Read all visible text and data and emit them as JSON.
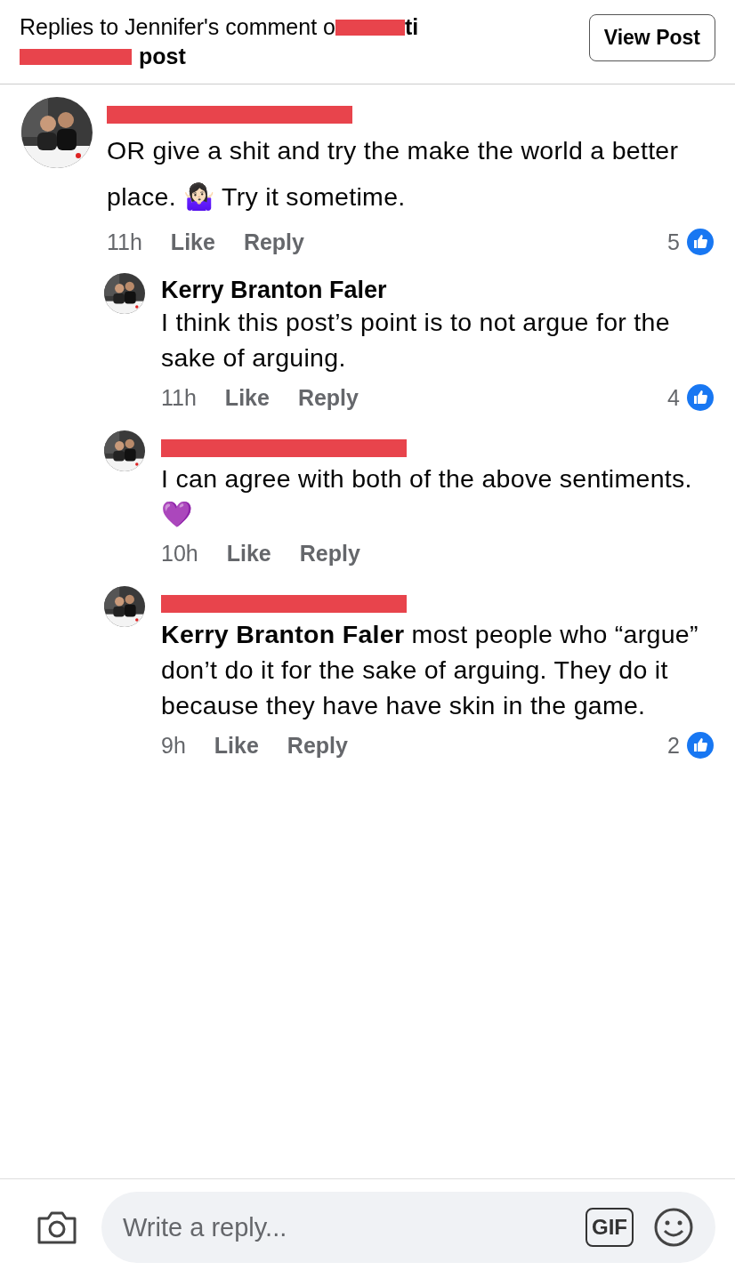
{
  "header": {
    "title_line1": "Replies to Jennifer's comment o",
    "title_line1_tail": "ti",
    "title_line2": "post",
    "button": "View Post"
  },
  "comments": [
    {
      "redacted": true,
      "text": "OR give a shit and try the make the world a better place. 🤷🏻‍♀️ Try it sometime.",
      "time": "11h",
      "like": "Like",
      "reply": "Reply",
      "reactions": "5",
      "replies": [
        {
          "name": "Kerry Branton Faler",
          "redacted": false,
          "text": "I think this post’s point is to not argue for the sake of arguing.",
          "time": "11h",
          "like": "Like",
          "reply": "Reply",
          "reactions": "4"
        },
        {
          "redacted": true,
          "text": "I can agree with both of the above sentiments. 💜",
          "time": "10h",
          "like": "Like",
          "reply": "Reply"
        },
        {
          "redacted": true,
          "text": "**Kerry Branton Faler** most people who “argue” don’t do it for the sake of arguing. They do it because they have have skin in the game.",
          "time": "9h",
          "like": "Like",
          "reply": "Reply",
          "reactions": "2"
        }
      ]
    }
  ],
  "composer": {
    "placeholder": "Write a reply...",
    "gif": "GIF"
  }
}
